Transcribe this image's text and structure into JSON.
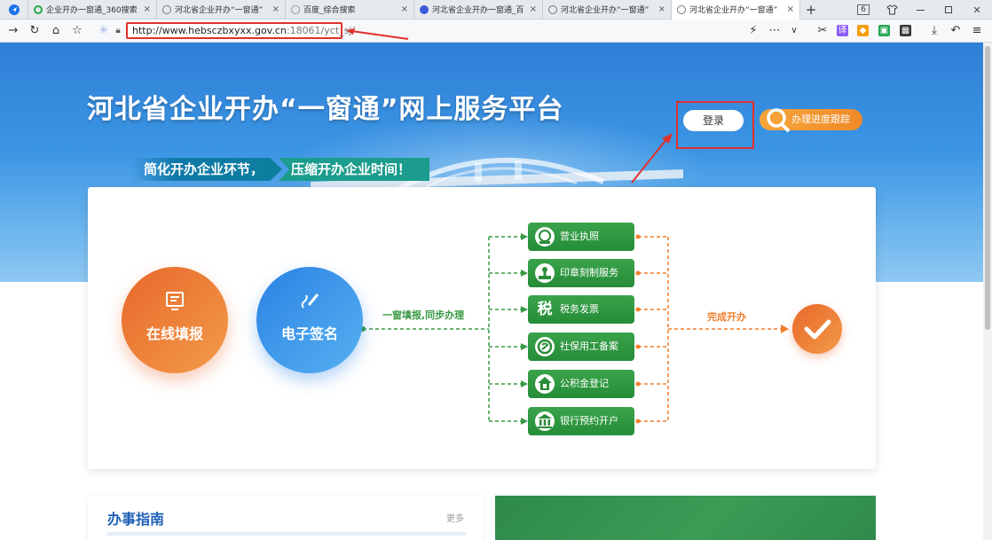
{
  "browser": {
    "tabs": [
      {
        "label": "企业开办一窗通_360搜索",
        "icon_color": "#28a745",
        "active": false
      },
      {
        "label": "河北省企业开办“一窗通”",
        "icon_color": "#777777",
        "active": false
      },
      {
        "label": "百度_综合搜索",
        "icon_color": "#999999",
        "active": false
      },
      {
        "label": "河北省企业开办一窗通_百",
        "icon_color": "#3b5bd6",
        "active": false
      },
      {
        "label": "河北省企业开办“一窗通”",
        "icon_color": "#777777",
        "active": false
      },
      {
        "label": "河北省企业开办“一窗通”",
        "icon_color": "#777777",
        "active": true
      }
    ],
    "tab_close": "×",
    "new_tab": "+",
    "tab_count": "6",
    "url_host": "http://www.hebsczbxyxx.gov.cn",
    "url_path": ":18061/yct_sj/",
    "colors": {
      "highlight": "#e0312d"
    }
  },
  "hero": {
    "title": "河北省企业开办“一窗通”网上服务平台",
    "slogan_1": "简化开办企业环节，",
    "slogan_2": "压缩开办企业时间！",
    "login_label": "登录",
    "progress_label": "办理进度跟踪"
  },
  "flow": {
    "step_1": "在线填报",
    "step_2": "电子签名",
    "connector_label": "一窗填报,同步办理",
    "complete_label": "完成开办",
    "services": [
      {
        "label": "营业执照",
        "icon": "license-icon"
      },
      {
        "label": "印章刻制服务",
        "icon": "seal-icon"
      },
      {
        "label": "税务发票",
        "icon": "tax-icon"
      },
      {
        "label": "社保用工备案",
        "icon": "social-security-icon"
      },
      {
        "label": "公积金登记",
        "icon": "housing-fund-icon"
      },
      {
        "label": "银行预约开户",
        "icon": "bank-icon"
      }
    ],
    "tax_glyph": "税",
    "colors": {
      "green": "#3a9a44",
      "orange": "#f07f2d",
      "blue": "#2a82e4"
    }
  },
  "guide": {
    "title": "办事指南",
    "more": "更多"
  }
}
